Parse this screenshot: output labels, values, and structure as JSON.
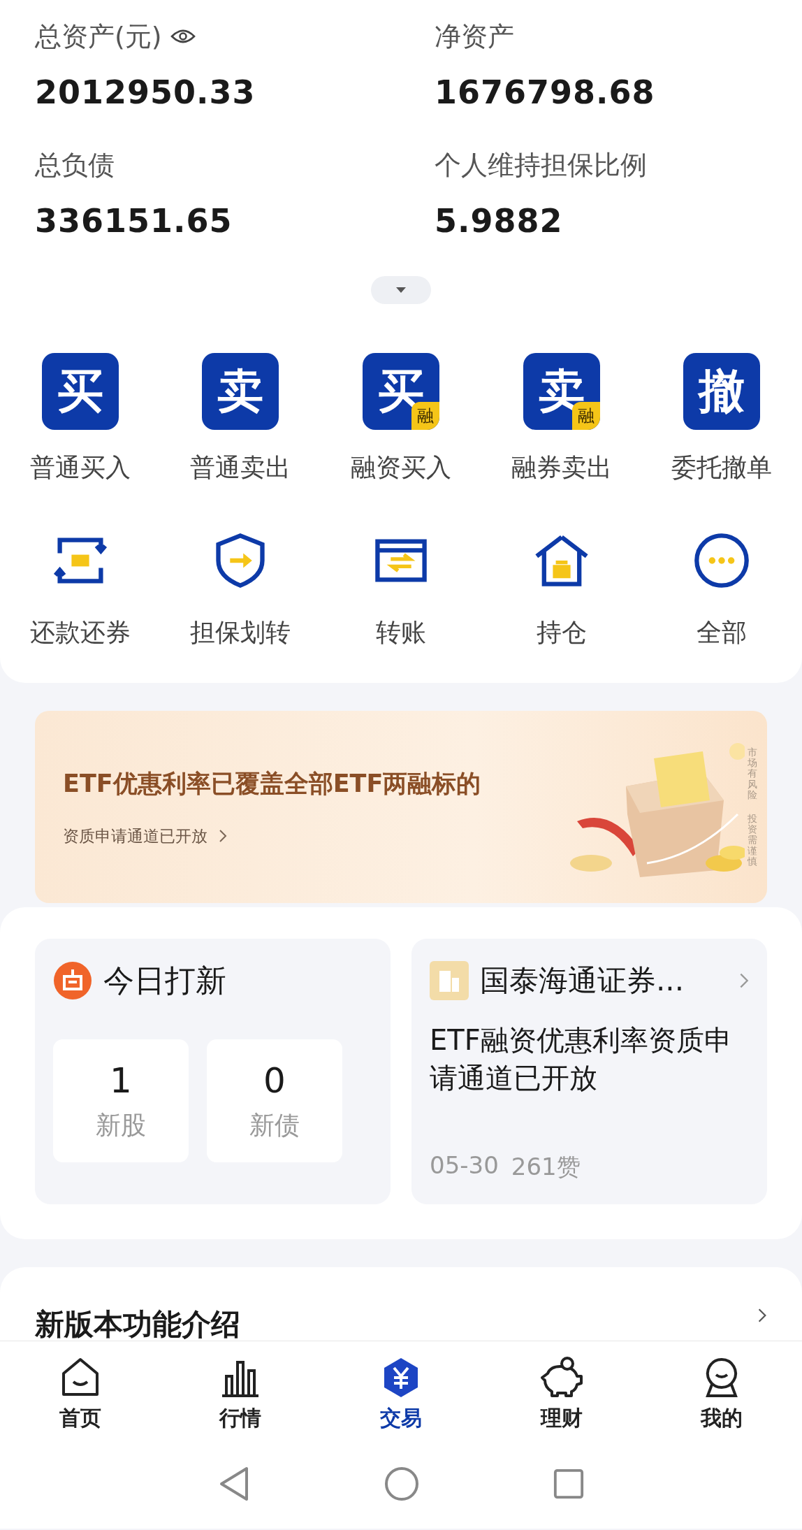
{
  "summary": [
    {
      "label": "总资产(元)",
      "value": "2012950.33",
      "eye": true
    },
    {
      "label": "净资产",
      "value": "1676798.68",
      "eye": false
    },
    {
      "label": "总负债",
      "value": "336151.65",
      "eye": false
    },
    {
      "label": "个人维持担保比例",
      "value": "5.9882",
      "eye": false
    }
  ],
  "summary_expanded": false,
  "actions": [
    {
      "kind": "glyph",
      "glyph": "买",
      "label": "普通买入"
    },
    {
      "kind": "glyph",
      "glyph": "卖",
      "label": "普通卖出"
    },
    {
      "kind": "glyph",
      "glyph": "买",
      "badge": "融",
      "label": "融资买入"
    },
    {
      "kind": "glyph",
      "glyph": "卖",
      "badge": "融",
      "label": "融券卖出"
    },
    {
      "kind": "glyph",
      "glyph": "撤",
      "label": "委托撤单"
    },
    {
      "kind": "repay",
      "label": "还款还券"
    },
    {
      "kind": "shield",
      "label": "担保划转"
    },
    {
      "kind": "transfer",
      "label": "转账"
    },
    {
      "kind": "house",
      "label": "持仓"
    },
    {
      "kind": "more",
      "label": "全部"
    }
  ],
  "banner": {
    "headline": "ETF优惠利率已覆盖全部ETF两融标的",
    "link": "资质申请通道已开放",
    "disclaimer": [
      "市场有风险",
      "投资需谨慎"
    ]
  },
  "ipo": {
    "title": "今日打新",
    "stats": [
      {
        "value": "1",
        "label": "新股"
      },
      {
        "value": "0",
        "label": "新债"
      }
    ]
  },
  "news": {
    "source": "国泰海通证券...",
    "title": "ETF融资优惠利率资质申请通道已开放",
    "date": "05-30",
    "likes": "261赞"
  },
  "feature": {
    "title": "新版本功能介绍"
  },
  "nav": [
    {
      "kind": "home",
      "label": "首页",
      "selected": false
    },
    {
      "kind": "market",
      "label": "行情",
      "selected": false
    },
    {
      "kind": "trade",
      "label": "交易",
      "selected": true
    },
    {
      "kind": "wealth",
      "label": "理财",
      "selected": false
    },
    {
      "kind": "profile",
      "label": "我的",
      "selected": false
    }
  ]
}
